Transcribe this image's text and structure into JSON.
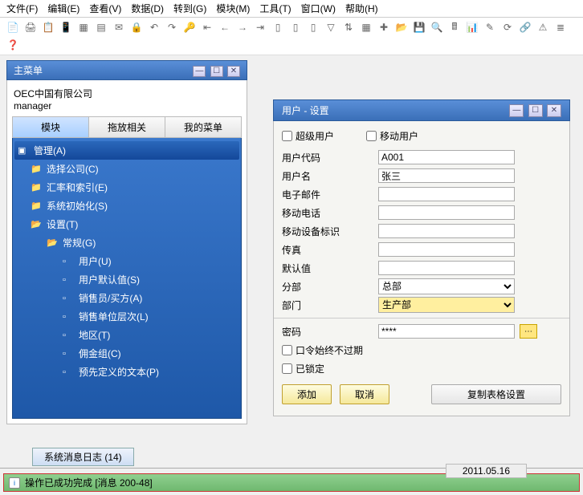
{
  "menubar": [
    "文件(F)",
    "编辑(E)",
    "查看(V)",
    "数据(D)",
    "转到(G)",
    "模块(M)",
    "工具(T)",
    "窗口(W)",
    "帮助(H)"
  ],
  "toolbar_icons": [
    "doc",
    "print",
    "copy",
    "phone",
    "excel",
    "word",
    "mail",
    "lock",
    "undo",
    "redo",
    "key",
    "fwd",
    "back",
    "top",
    "bot",
    "page1",
    "page2",
    "page3",
    "filter",
    "sort",
    "grid",
    "new",
    "open",
    "save",
    "find",
    "calc",
    "chart",
    "pencil",
    "refresh",
    "link",
    "warn",
    "stack",
    "help"
  ],
  "leftwin": {
    "title": "主菜单",
    "company": "OEC中国有限公司",
    "role": "manager",
    "tabs": [
      "模块",
      "拖放相关",
      "我的菜单"
    ],
    "tree_root": "管理(A)",
    "tree": [
      {
        "d": 1,
        "t": "选择公司(C)",
        "o": false
      },
      {
        "d": 1,
        "t": "汇率和索引(E)",
        "o": false
      },
      {
        "d": 1,
        "t": "系统初始化(S)",
        "o": false
      },
      {
        "d": 1,
        "t": "设置(T)",
        "o": true
      },
      {
        "d": 2,
        "t": "常规(G)",
        "o": true
      },
      {
        "d": 3,
        "t": "用户(U)"
      },
      {
        "d": 3,
        "t": "用户默认值(S)"
      },
      {
        "d": 3,
        "t": "销售员/买方(A)"
      },
      {
        "d": 3,
        "t": "销售单位层次(L)"
      },
      {
        "d": 3,
        "t": "地区(T)"
      },
      {
        "d": 3,
        "t": "佣金组(C)"
      },
      {
        "d": 3,
        "t": "预先定义的文本(P)"
      }
    ]
  },
  "rightwin": {
    "title": "用户 - 设置",
    "chk_super": "超级用户",
    "chk_mobile": "移动用户",
    "fields": {
      "usercode": {
        "label": "用户代码",
        "value": "A001"
      },
      "username": {
        "label": "用户名",
        "value": "张三"
      },
      "email": {
        "label": "电子邮件",
        "value": ""
      },
      "mobile": {
        "label": "移动电话",
        "value": ""
      },
      "devid": {
        "label": "移动设备标识",
        "value": ""
      },
      "fax": {
        "label": "传真",
        "value": ""
      },
      "defaults": {
        "label": "默认值",
        "value": ""
      },
      "branch": {
        "label": "分部",
        "value": "总部"
      },
      "dept": {
        "label": "部门",
        "value": "生产部"
      },
      "password": {
        "label": "密码",
        "value": "****"
      }
    },
    "chk_neverexpire": "口令始终不过期",
    "chk_locked": "已锁定",
    "btn_add": "添加",
    "btn_cancel": "取消",
    "btn_copy": "复制表格设置"
  },
  "log": {
    "tab": "系统消息日志 (14)",
    "date": "2011.05.16",
    "line": "操作已成功完成  [消息 200-48]"
  }
}
